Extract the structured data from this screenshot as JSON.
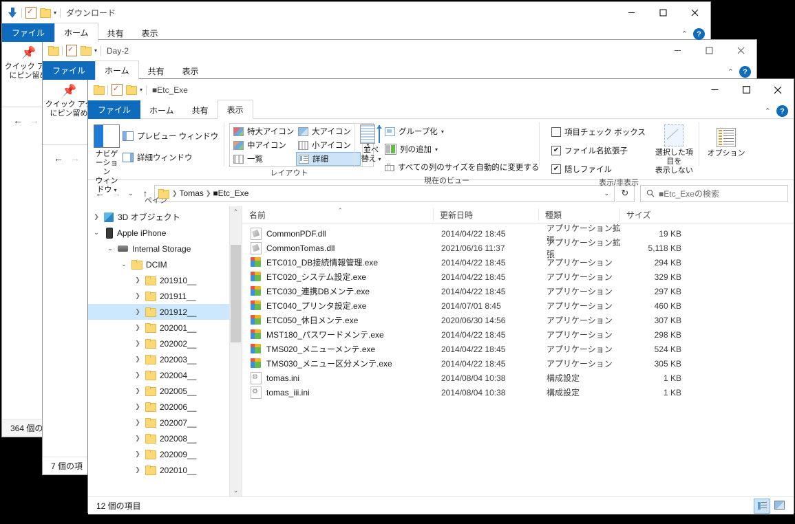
{
  "windows": {
    "back1": {
      "title": "ダウンロード",
      "tabs": [
        "ファイル",
        "ホーム",
        "共有",
        "表示"
      ],
      "pin_label_line1": "クイック アク",
      "pin_label_line2": "にピン留め",
      "status": "364 個の"
    },
    "back2": {
      "title": "Day-2",
      "tabs": [
        "ファイル",
        "ホーム",
        "共有",
        "表示"
      ],
      "pin_label_line1": "クイック アク",
      "pin_label_line2": "にピン留め",
      "status": "7 個の項"
    },
    "front": {
      "title": "■Etc_Exe",
      "tabs": [
        "ファイル",
        "ホーム",
        "共有",
        "表示"
      ],
      "active_tab": "表示",
      "minimize": "—",
      "maximize": "☐",
      "close": "✕",
      "status": "12 個の項目"
    }
  },
  "ribbon": {
    "groups": [
      {
        "name": "ペイン",
        "label": "ペイン",
        "big_button": {
          "label_line1": "ナビゲーション",
          "label_line2": "ウィンドウ"
        },
        "small_buttons": [
          "プレビュー ウィンドウ",
          "詳細ウィンドウ"
        ]
      },
      {
        "name": "レイアウト",
        "label": "レイアウト",
        "items": [
          "特大アイコン",
          "大アイコン",
          "中アイコン",
          "小アイコン",
          "一覧",
          "詳細"
        ],
        "selected": "詳細"
      },
      {
        "name": "現在のビュー",
        "label": "現在のビュー",
        "sort_label": "並べ替え",
        "small_buttons": [
          "グループ化",
          "列の追加",
          "すべての列のサイズを自動的に変更する"
        ]
      },
      {
        "name": "表示/非表示",
        "label": "表示/非表示",
        "checkboxes": [
          {
            "label": "項目チェック ボックス",
            "checked": false
          },
          {
            "label": "ファイル名拡張子",
            "checked": true
          },
          {
            "label": "隠しファイル",
            "checked": true
          }
        ],
        "hide_button": {
          "label_line1": "選択した項目を",
          "label_line2": "表示しない"
        }
      },
      {
        "name": "オプション",
        "label": "",
        "options_label": "オプション"
      }
    ]
  },
  "addressbar": {
    "back": "←",
    "forward": "→",
    "recent": "⌄",
    "up": "↑",
    "crumbs": [
      "Tomas",
      "■Etc_Exe"
    ],
    "dropdown_caret": "⌄",
    "refresh": "↻",
    "search_placeholder": "■Etc_Exeの検索",
    "search_icon": "search-icon"
  },
  "nav_tree": [
    {
      "label": "3D オブジェクト",
      "indent": 0,
      "expander": "collapsed",
      "icon": "3d-objects-icon",
      "selected": false
    },
    {
      "label": "Apple iPhone",
      "indent": 0,
      "expander": "expanded",
      "icon": "phone-icon",
      "selected": false
    },
    {
      "label": "Internal Storage",
      "indent": 1,
      "expander": "expanded",
      "icon": "drive-icon",
      "selected": false
    },
    {
      "label": "DCIM",
      "indent": 2,
      "expander": "expanded",
      "icon": "folder-icon",
      "selected": false
    },
    {
      "label": "201910__",
      "indent": 3,
      "expander": "collapsed",
      "icon": "folder-icon",
      "selected": false
    },
    {
      "label": "201911__",
      "indent": 3,
      "expander": "collapsed",
      "icon": "folder-icon",
      "selected": false
    },
    {
      "label": "201912__",
      "indent": 3,
      "expander": "collapsed",
      "icon": "folder-icon",
      "selected": true
    },
    {
      "label": "202001__",
      "indent": 3,
      "expander": "collapsed",
      "icon": "folder-icon",
      "selected": false
    },
    {
      "label": "202002__",
      "indent": 3,
      "expander": "collapsed",
      "icon": "folder-icon",
      "selected": false
    },
    {
      "label": "202003__",
      "indent": 3,
      "expander": "collapsed",
      "icon": "folder-icon",
      "selected": false
    },
    {
      "label": "202004__",
      "indent": 3,
      "expander": "collapsed",
      "icon": "folder-icon",
      "selected": false
    },
    {
      "label": "202005__",
      "indent": 3,
      "expander": "collapsed",
      "icon": "folder-icon",
      "selected": false
    },
    {
      "label": "202006__",
      "indent": 3,
      "expander": "collapsed",
      "icon": "folder-icon",
      "selected": false
    },
    {
      "label": "202007__",
      "indent": 3,
      "expander": "collapsed",
      "icon": "folder-icon",
      "selected": false
    },
    {
      "label": "202008__",
      "indent": 3,
      "expander": "collapsed",
      "icon": "folder-icon",
      "selected": false
    },
    {
      "label": "202009__",
      "indent": 3,
      "expander": "collapsed",
      "icon": "folder-icon",
      "selected": false
    },
    {
      "label": "202010__",
      "indent": 3,
      "expander": "collapsed",
      "icon": "folder-icon",
      "selected": false
    }
  ],
  "file_list": {
    "columns": [
      "名前",
      "更新日時",
      "種類",
      "サイズ"
    ],
    "sort_column": "名前",
    "sort_direction": "asc",
    "rows": [
      {
        "name": "CommonPDF.dll",
        "icon": "dll-icon",
        "modified": "2014/04/22 18:45",
        "type": "アプリケーション拡張",
        "size": "19 KB"
      },
      {
        "name": "CommonTomas.dll",
        "icon": "dll-icon",
        "modified": "2021/06/16 11:37",
        "type": "アプリケーション拡張",
        "size": "5,118 KB"
      },
      {
        "name": "ETC010_DB接続情報管理.exe",
        "icon": "exe-icon",
        "modified": "2014/04/22 18:45",
        "type": "アプリケーション",
        "size": "294 KB"
      },
      {
        "name": "ETC020_システム設定.exe",
        "icon": "exe-icon",
        "modified": "2014/04/22 18:45",
        "type": "アプリケーション",
        "size": "329 KB"
      },
      {
        "name": "ETC030_連携DBメンテ.exe",
        "icon": "exe-icon",
        "modified": "2014/04/22 18:45",
        "type": "アプリケーション",
        "size": "297 KB"
      },
      {
        "name": "ETC040_プリンタ設定.exe",
        "icon": "exe-icon",
        "modified": "2014/07/01 8:45",
        "type": "アプリケーション",
        "size": "460 KB"
      },
      {
        "name": "ETC050_休日メンテ.exe",
        "icon": "exe-icon",
        "modified": "2020/06/30 14:56",
        "type": "アプリケーション",
        "size": "307 KB"
      },
      {
        "name": "MST180_パスワードメンテ.exe",
        "icon": "exe-icon",
        "modified": "2014/04/22 18:45",
        "type": "アプリケーション",
        "size": "298 KB"
      },
      {
        "name": "TMS020_メニューメンテ.exe",
        "icon": "exe-icon",
        "modified": "2014/04/22 18:45",
        "type": "アプリケーション",
        "size": "524 KB"
      },
      {
        "name": "TMS030_メニュー区分メンテ.exe",
        "icon": "exe-icon",
        "modified": "2014/04/22 18:45",
        "type": "アプリケーション",
        "size": "305 KB"
      },
      {
        "name": "tomas.ini",
        "icon": "ini-icon",
        "modified": "2014/08/04 10:38",
        "type": "構成設定",
        "size": "1 KB"
      },
      {
        "name": "tomas_iii.ini",
        "icon": "ini-icon",
        "modified": "2014/08/04 10:38",
        "type": "構成設定",
        "size": "1 KB"
      }
    ]
  },
  "colors": {
    "accent": "#0f6cbd",
    "selection": "#cce8ff",
    "gallery_selection": "#cce4f7",
    "folder": "#fcd975"
  }
}
